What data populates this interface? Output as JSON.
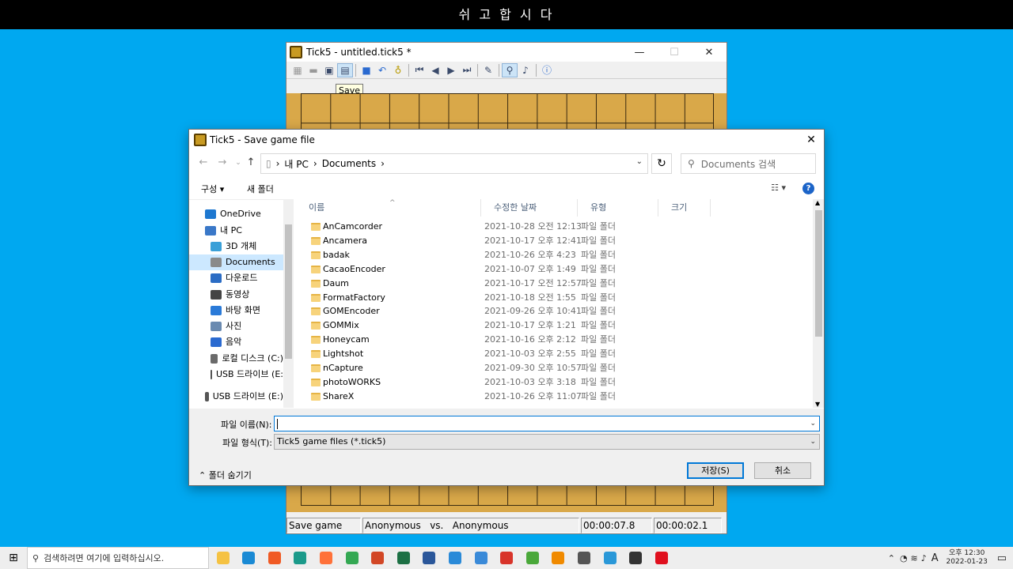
{
  "banner": "쉬 고 합 시 다",
  "app": {
    "title": "Tick5 - untitled.tick5 *",
    "tooltip": "Save",
    "status": {
      "action": "Save game",
      "players": "Anonymous   vs.   Anonymous",
      "time1": "00:00:07.8",
      "time2": "00:00:02.1"
    }
  },
  "dialog": {
    "title": "Tick5 - Save game file",
    "breadcrumb": [
      "내 PC",
      "Documents"
    ],
    "search_placeholder": "Documents 검색",
    "organize": "구성 ▾",
    "new_folder": "새 폴더",
    "columns": {
      "name": "이름",
      "date": "수정한 날짜",
      "type": "유형",
      "size": "크기"
    },
    "tree": [
      {
        "label": "OneDrive",
        "color": "#1e78d0"
      },
      {
        "label": "내 PC",
        "color": "#3a78c8"
      },
      {
        "label": "3D 개체",
        "color": "#3aa0d8"
      },
      {
        "label": "Documents",
        "color": "#8a8a8a"
      },
      {
        "label": "다운로드",
        "color": "#2b6cc4"
      },
      {
        "label": "동영상",
        "color": "#444444"
      },
      {
        "label": "바탕 화면",
        "color": "#2a7ad8"
      },
      {
        "label": "사진",
        "color": "#6a8ab0"
      },
      {
        "label": "음악",
        "color": "#2a6ad0"
      },
      {
        "label": "로컬 디스크 (C:)",
        "color": "#6a6a6a"
      },
      {
        "label": "USB 드라이브 (E:",
        "color": "#555555"
      },
      {
        "label": "USB 드라이브 (E:)",
        "color": "#555555"
      }
    ],
    "files": [
      {
        "name": "AnCamcorder",
        "date": "2021-10-28 오전 12:13",
        "type": "파일 폴더"
      },
      {
        "name": "Ancamera",
        "date": "2021-10-17 오후 12:41",
        "type": "파일 폴더"
      },
      {
        "name": "badak",
        "date": "2021-10-26 오후 4:23",
        "type": "파일 폴더"
      },
      {
        "name": "CacaoEncoder",
        "date": "2021-10-07 오후 1:49",
        "type": "파일 폴더"
      },
      {
        "name": "Daum",
        "date": "2021-10-17 오전 12:57",
        "type": "파일 폴더"
      },
      {
        "name": "FormatFactory",
        "date": "2021-10-18 오전 1:55",
        "type": "파일 폴더"
      },
      {
        "name": "GOMEncoder",
        "date": "2021-09-26 오후 10:41",
        "type": "파일 폴더"
      },
      {
        "name": "GOMMix",
        "date": "2021-10-17 오후 1:21",
        "type": "파일 폴더"
      },
      {
        "name": "Honeycam",
        "date": "2021-10-16 오후 2:12",
        "type": "파일 폴더"
      },
      {
        "name": "Lightshot",
        "date": "2021-10-03 오후 2:55",
        "type": "파일 폴더"
      },
      {
        "name": "nCapture",
        "date": "2021-09-30 오후 10:57",
        "type": "파일 폴더"
      },
      {
        "name": "photoWORKS",
        "date": "2021-10-03 오후 3:18",
        "type": "파일 폴더"
      },
      {
        "name": "ShareX",
        "date": "2021-10-26 오후 11:07",
        "type": "파일 폴더"
      }
    ],
    "filename_label": "파일 이름(N):",
    "filename_value": "",
    "filetype_label": "파일 형식(T):",
    "filetype_value": "Tick5 game files (*.tick5)",
    "save": "저장(S)",
    "cancel": "취소",
    "hide_folders": "폴더 숨기기"
  },
  "taskbar": {
    "search_placeholder": "검색하려면 여기에 입력하십시오.",
    "apps": [
      {
        "name": "file-explorer",
        "color": "#f5c242"
      },
      {
        "name": "edge",
        "color": "#1a8ad4"
      },
      {
        "name": "brave",
        "color": "#f05a24"
      },
      {
        "name": "app-s",
        "color": "#1b9a8a"
      },
      {
        "name": "firefox",
        "color": "#ff7139"
      },
      {
        "name": "chrome",
        "color": "#34a853"
      },
      {
        "name": "powerpoint",
        "color": "#d24726"
      },
      {
        "name": "excel",
        "color": "#1d7044"
      },
      {
        "name": "word",
        "color": "#2b579a"
      },
      {
        "name": "app-monitor",
        "color": "#2a8ad8"
      },
      {
        "name": "paint",
        "color": "#3a8ad8"
      },
      {
        "name": "app-se",
        "color": "#d8342a"
      },
      {
        "name": "app-green",
        "color": "#4aa83a"
      },
      {
        "name": "vlc",
        "color": "#f08a00"
      },
      {
        "name": "calculator",
        "color": "#555555"
      },
      {
        "name": "app-blue",
        "color": "#2a98d8"
      },
      {
        "name": "sticky",
        "color": "#333333"
      },
      {
        "name": "opera",
        "color": "#e0101e"
      }
    ],
    "time": "오후 12:30",
    "date": "2022-01-23",
    "ime": "A"
  }
}
